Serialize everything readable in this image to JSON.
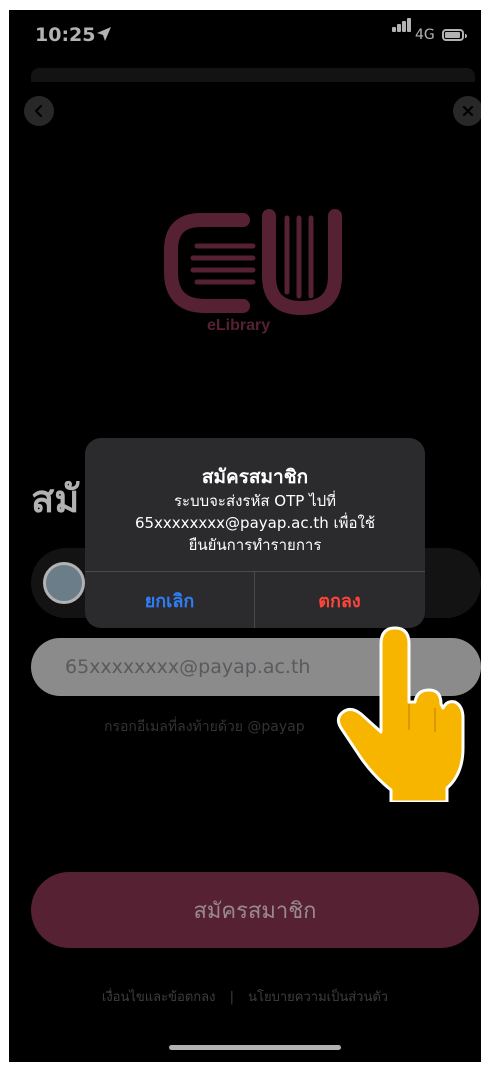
{
  "status_bar": {
    "time": "10:25",
    "network": "4G"
  },
  "logo": {
    "text": "eLibrary",
    "brand_color": "#7a3049"
  },
  "background": {
    "title_partial": "สมั",
    "email_value": "65xxxxxxxx@payap.ac.th",
    "hint": "กรอกอีเมลที่ลงท้ายด้วย @payap",
    "submit_label": "สมัครสมาชิก",
    "footer_terms": "เงื่อนไขและข้อตกลง",
    "footer_separator": "|",
    "footer_privacy": "นโยบายความเป็นส่วนตัว"
  },
  "dialog": {
    "title": "สมัครสมาชิก",
    "message_line1": "ระบบจะส่งรหัส OTP ไปที่",
    "message_line2": "65xxxxxxxx@payap.ac.th เพื่อใช้",
    "message_line3": "ยืนยันการทำรายการ",
    "cancel_label": "ยกเลิก",
    "ok_label": "ตกลง"
  },
  "icons": [
    "location-arrow-icon",
    "signal-icon",
    "battery-icon",
    "back-icon",
    "close-icon",
    "university-seal-icon",
    "pointing-hand-icon"
  ]
}
